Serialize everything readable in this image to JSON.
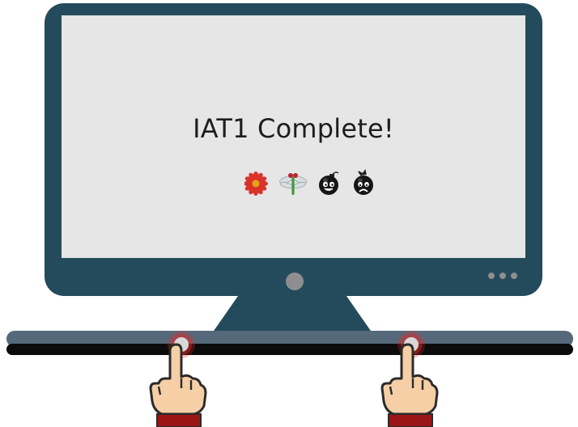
{
  "screen": {
    "message": "IAT1 Complete!",
    "icons": [
      "flower-icon",
      "dragonfly-icon",
      "happy-bomb-icon",
      "sad-bomb-icon"
    ]
  },
  "monitor": {
    "bezel_color": "#244b5c",
    "screen_color": "#e6e6e6",
    "indicator_dots": 3
  },
  "keys": {
    "left": "press-indicator",
    "right": "press-indicator",
    "glow_color": "#e02b2b"
  }
}
